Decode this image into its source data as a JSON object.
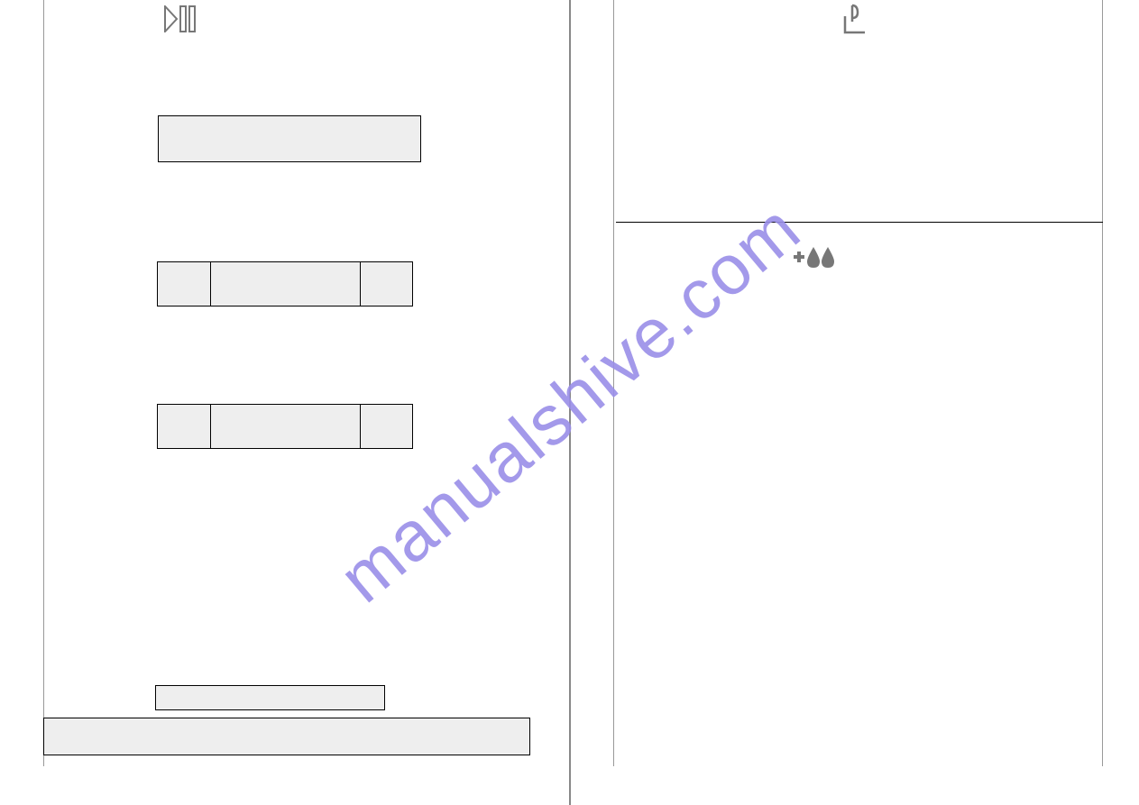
{
  "left": {
    "icon": "play-pause-icon"
  },
  "right": {
    "icon_top": "power-icon",
    "icon_mid": "water-drops-icon"
  },
  "watermark": "manualshive.com"
}
